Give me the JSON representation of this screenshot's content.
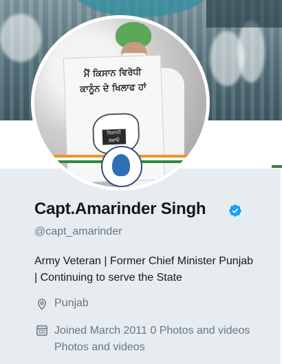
{
  "profile": {
    "display_name": "Capt.Amarinder Singh",
    "handle": "@capt_amarinder",
    "bio": "Army Veteran | Former Chief Minister Punjab | Continuing to serve the State",
    "location": "Punjab",
    "joined": "Joined March 2011 0 Photos and videos Photos and videos",
    "verified": true
  },
  "avatar_sign": {
    "line1": "ਮੈਂ ਕਿਸਾਨ ਵਿਰੋਧੀ",
    "line2": "ਕਾਨੂੰਨ ਦੇ ਖਿਲਾਫ ਹਾਂ",
    "badge": "ਕਿਸਾਨੀ ਬਚਾਓ"
  },
  "icons": {
    "verified": "verified-badge-icon",
    "location": "location-pin-icon",
    "calendar": "calendar-icon"
  },
  "colors": {
    "verified_blue": "#1da1f2",
    "secondary_text": "#657786",
    "primary_text": "#14171a",
    "card_background": "#e6ecf0"
  }
}
